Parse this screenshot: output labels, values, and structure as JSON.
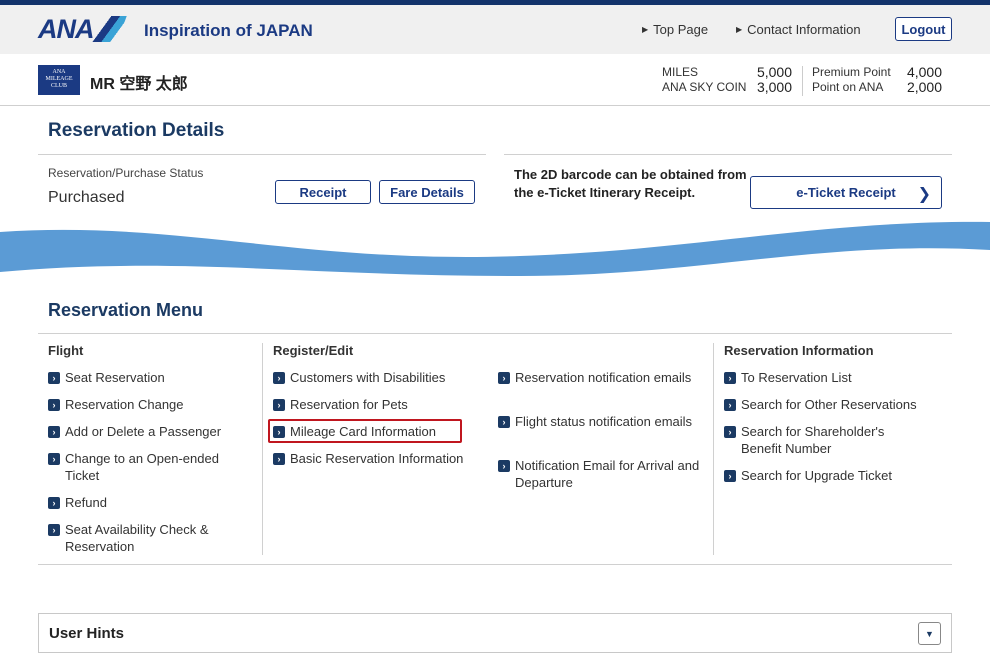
{
  "header": {
    "logo_text": "ANA",
    "tagline": "Inspiration of JAPAN",
    "nav": [
      {
        "label": "Top Page"
      },
      {
        "label": "Contact Information"
      }
    ],
    "logout_label": "Logout"
  },
  "member": {
    "badge_lines": [
      "ANA",
      "MILEAGE",
      "CLUB"
    ],
    "name": "MR 空野 太郎",
    "miles_label": "MILES",
    "miles_value": "5,000",
    "skycoin_label": "ANA SKY COIN",
    "skycoin_value": "3,000",
    "premium_label": "Premium Point",
    "premium_value": "4,000",
    "pointana_label": "Point on ANA",
    "pointana_value": "2,000"
  },
  "details": {
    "title": "Reservation Details",
    "status_label": "Reservation/Purchase Status",
    "status_value": "Purchased",
    "receipt_label": "Receipt",
    "fare_label": "Fare Details",
    "barcode_note": "The 2D barcode can be obtained from the e-Ticket Itinerary Receipt.",
    "eticket_label": "e-Ticket Receipt"
  },
  "menu": {
    "title": "Reservation Menu",
    "flight": {
      "title": "Flight",
      "items": [
        "Seat Reservation",
        "Reservation Change",
        "Add or Delete a Passenger",
        "Change to an Open-ended Ticket",
        "Refund",
        "Seat Availability Check & Reservation"
      ]
    },
    "register": {
      "title": "Register/Edit",
      "items": [
        "Customers with Disabilities",
        "Reservation for Pets",
        "Mileage Card Information",
        "Basic Reservation Information"
      ],
      "items2": [
        "Reservation notification emails",
        "Flight status notification emails",
        "Notification Email for Arrival and Departure"
      ]
    },
    "info": {
      "title": "Reservation Information",
      "items": [
        "To Reservation List",
        "Search for Other Reservations",
        "Search for Shareholder's Benefit Number",
        "Search for Upgrade Ticket"
      ]
    }
  },
  "hints": {
    "title": "User Hints"
  },
  "colors": {
    "brand_navy": "#1b3a83",
    "wave_blue": "#5b9bd5",
    "highlight_red": "#c0161f"
  }
}
